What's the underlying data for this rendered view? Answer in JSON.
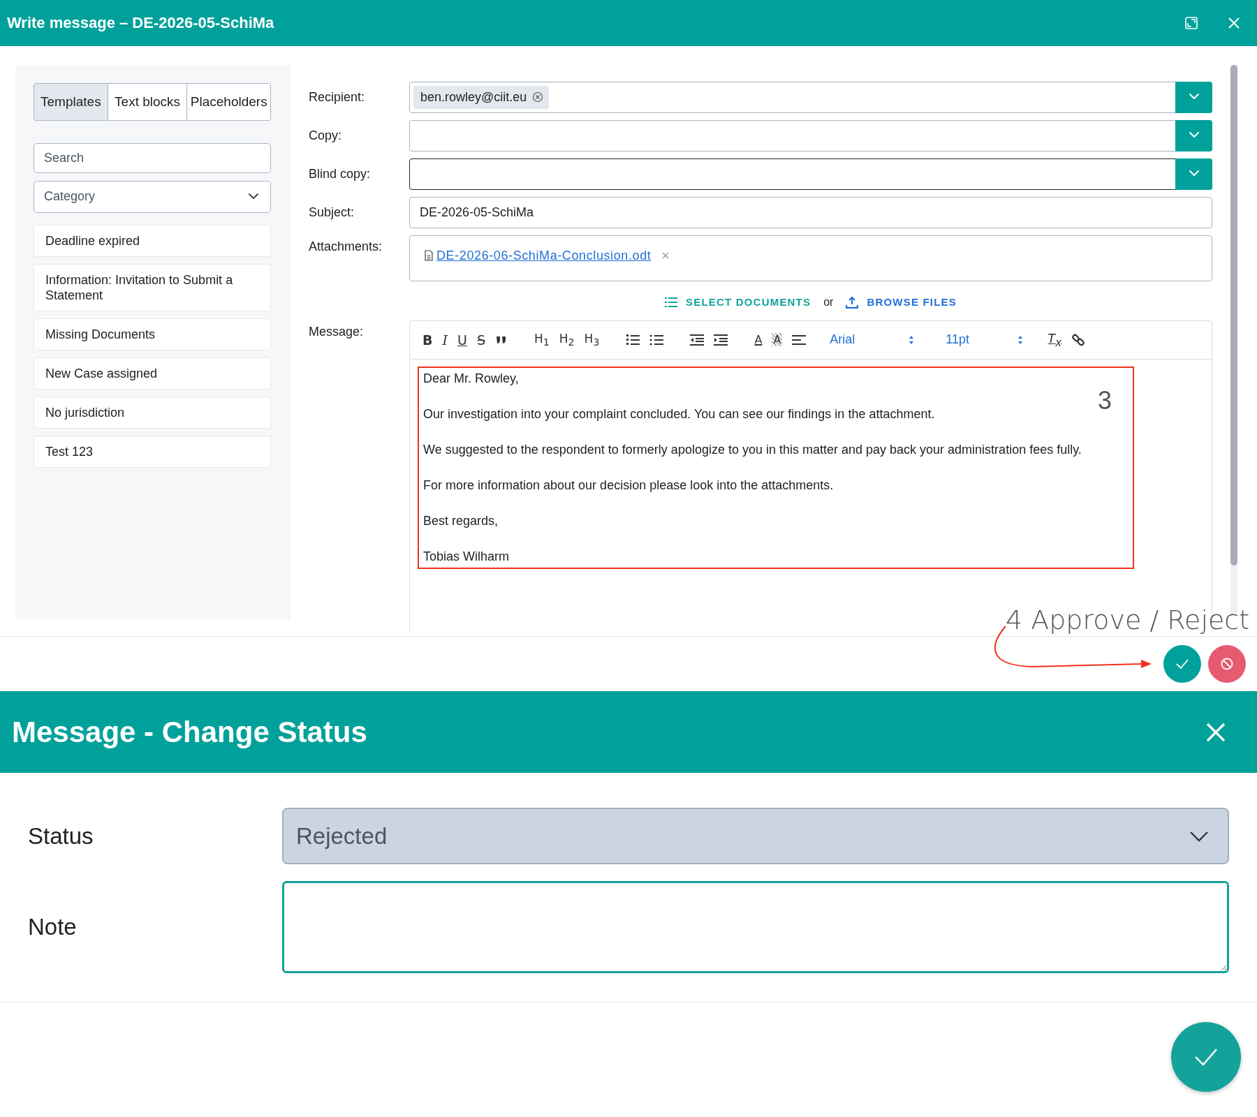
{
  "window": {
    "title": "Write message – DE-2026-05-SchiMa"
  },
  "sidebar": {
    "tabs": [
      {
        "label": "Templates",
        "selected": true
      },
      {
        "label": "Text blocks",
        "selected": false
      },
      {
        "label": "Placeholders",
        "selected": false
      }
    ],
    "search": {
      "placeholder": "Search"
    },
    "category": {
      "placeholder": "Category"
    },
    "templates": [
      "Deadline expired",
      "Information: Invitation to Submit a Statement",
      "Missing Documents",
      "New Case assigned",
      "No jurisdiction",
      "Test 123"
    ]
  },
  "form": {
    "recipient": {
      "label": "Recipient:",
      "chips": [
        "ben.rowley@ciit.eu"
      ]
    },
    "copy": {
      "label": "Copy:",
      "focused": false
    },
    "blind_copy": {
      "label": "Blind copy:",
      "focused": true
    },
    "subject": {
      "label": "Subject:",
      "value": "DE-2026-05-SchiMa"
    },
    "attachments": {
      "label": "Attachments:",
      "files": [
        "DE-2026-06-SchiMa-Conclusion.odt"
      ],
      "select_documents": "SELECT DOCUMENTS",
      "or": "or",
      "browse_files": "BROWSE FILES"
    },
    "message": {
      "label": "Message:",
      "text_styles": [
        "B",
        "I",
        "U",
        "S"
      ],
      "headings": [
        "H$_{1}$",
        "H$_{2}$",
        "H$_{3}$"
      ],
      "color_buttons": [
        "A",
        "A"
      ],
      "font": "Arial",
      "size": "11pt",
      "clear_format": "T$_{x}$",
      "paragraphs": [
        "Dear Mr. Rowley,",
        "Our investigation into your complaint concluded. You can see our findings in the attachment.",
        "We suggested to the respondent to formerly apologize to you in this matter and pay back your administration fees fully.",
        "For more information about our decision please look into the attachments.",
        "Best regards,",
        "Tobias Wilharm"
      ]
    }
  },
  "annotations": [
    {
      "kind": "number",
      "text": "3"
    },
    {
      "kind": "callout",
      "text": "4 Approve / Reject"
    }
  ],
  "status_dialog": {
    "title": "Message - Change Status",
    "status_label": "Status",
    "status_value": "Rejected",
    "note_label": "Note"
  }
}
